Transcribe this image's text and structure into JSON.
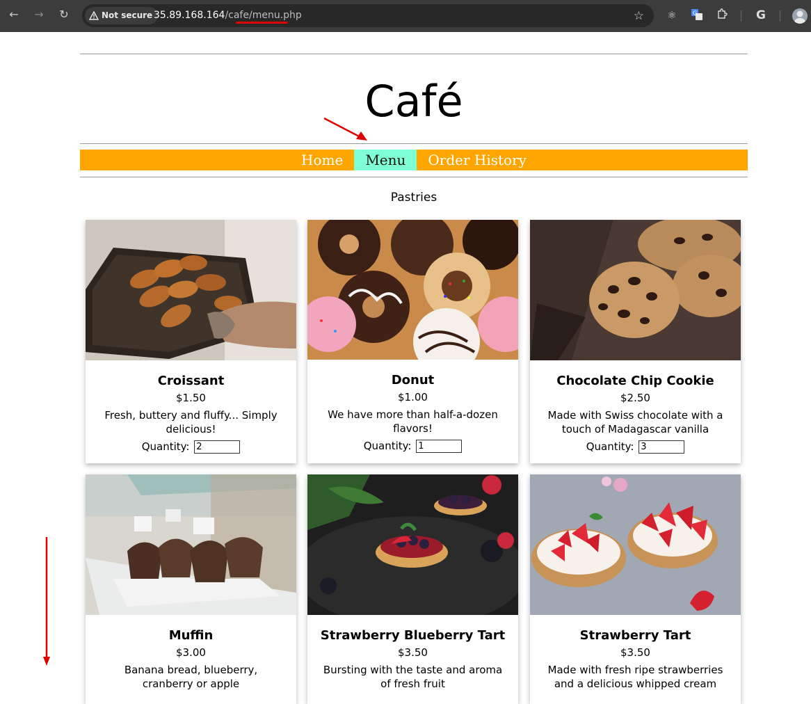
{
  "browser": {
    "security_label": "Not secure",
    "url_host": "35.89.168.164",
    "url_path": "/cafe/menu.php",
    "icons": [
      "back-arrow-icon",
      "forward-arrow-icon",
      "reload-icon",
      "warning-icon",
      "star-icon",
      "react-devtools-icon",
      "google-translate-icon",
      "extensions-icon",
      "google-icon",
      "profile-avatar-icon"
    ]
  },
  "site": {
    "title": "Café",
    "nav": [
      {
        "label": "Home",
        "active": false
      },
      {
        "label": "Menu",
        "active": true
      },
      {
        "label": "Order History",
        "active": false
      }
    ],
    "nav_color": "#ffa500",
    "nav_active_color": "#7fffd4"
  },
  "section": {
    "title": "Pastries"
  },
  "products": [
    {
      "name": "Croissant",
      "price": "$1.50",
      "description": "Fresh, buttery and fluffy... Simply delicious!",
      "quantity_label": "Quantity:",
      "quantity": "2"
    },
    {
      "name": "Donut",
      "price": "$1.00",
      "description": "We have more than half-a-dozen flavors!",
      "quantity_label": "Quantity:",
      "quantity": "1"
    },
    {
      "name": "Chocolate Chip Cookie",
      "price": "$2.50",
      "description": "Made with Swiss chocolate with a touch of Madagascar vanilla",
      "quantity_label": "Quantity:",
      "quantity": "3"
    },
    {
      "name": "Muffin",
      "price": "$3.00",
      "description": "Banana bread, blueberry, cranberry or apple"
    },
    {
      "name": "Strawberry Blueberry Tart",
      "price": "$3.50",
      "description": "Bursting with the taste and aroma of fresh fruit"
    },
    {
      "name": "Strawberry Tart",
      "price": "$3.50",
      "description": "Made with fresh ripe strawberries and a delicious whipped cream"
    }
  ],
  "annotations": {
    "arrow_color": "#e00000"
  }
}
